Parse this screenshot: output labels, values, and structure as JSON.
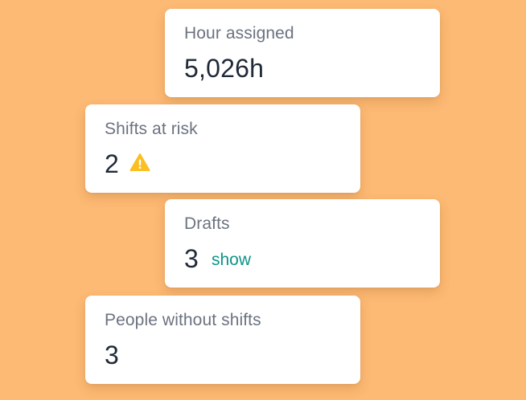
{
  "cards": [
    {
      "label": "Hour assigned",
      "value": "5,026h"
    },
    {
      "label": "Shifts at risk",
      "value": "2",
      "icon": "warning-icon",
      "icon_color": "#FBBF24"
    },
    {
      "label": "Drafts",
      "value": "3",
      "link_label": "show",
      "link_color": "#0D9488"
    },
    {
      "label": "People without shifts",
      "value": "3"
    }
  ],
  "colors": {
    "background": "#FDBA74",
    "card": "#FFFFFF",
    "label_text": "#6B7280",
    "value_text": "#1F2937"
  }
}
